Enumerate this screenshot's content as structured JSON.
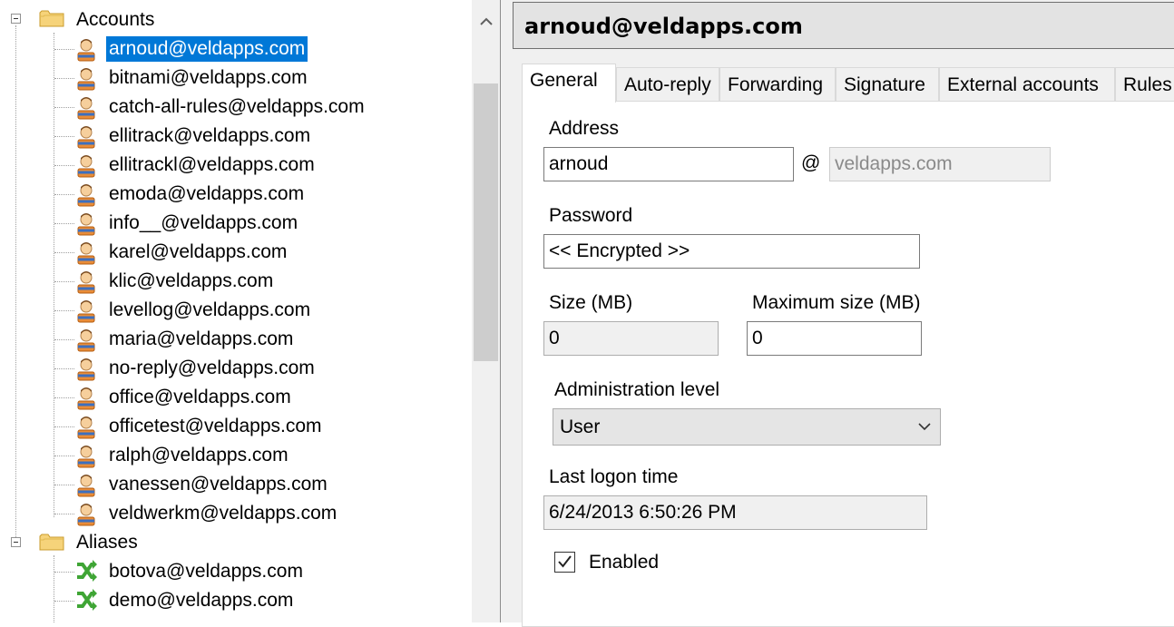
{
  "tree": {
    "accounts_label": "Accounts",
    "accounts": [
      "arnoud@veldapps.com",
      "bitnami@veldapps.com",
      "catch-all-rules@veldapps.com",
      "ellitrack@veldapps.com",
      "ellitrackl@veldapps.com",
      "emoda@veldapps.com",
      "info__@veldapps.com",
      "karel@veldapps.com",
      "klic@veldapps.com",
      "levellog@veldapps.com",
      "maria@veldapps.com",
      "no-reply@veldapps.com",
      "office@veldapps.com",
      "officetest@veldapps.com",
      "ralph@veldapps.com",
      "vanessen@veldapps.com",
      "veldwerkm@veldapps.com"
    ],
    "selected_account": "arnoud@veldapps.com",
    "aliases_label": "Aliases",
    "aliases": [
      "botova@veldapps.com",
      "demo@veldapps.com"
    ],
    "icons": {
      "folder": "folder-icon",
      "account": "user-account-icon",
      "alias": "alias-icon",
      "expander": "tree-collapse-icon",
      "scroll_up": "chevron-up-icon"
    }
  },
  "detail": {
    "title": "arnoud@veldapps.com",
    "tabs": [
      "General",
      "Auto-reply",
      "Forwarding",
      "Signature",
      "External accounts",
      "Rules"
    ],
    "active_tab": "General",
    "address_label": "Address",
    "address_value": "arnoud",
    "at_sign": "@",
    "domain_value": "veldapps.com",
    "password_label": "Password",
    "password_value": "<< Encrypted >>",
    "size_label": "Size (MB)",
    "size_value": "0",
    "max_size_label": "Maximum size (MB)",
    "max_size_value": "0",
    "admin_level_label": "Administration level",
    "admin_level_value": "User",
    "last_logon_label": "Last logon time",
    "last_logon_value": "6/24/2013 6:50:26 PM",
    "enabled_label": "Enabled",
    "enabled_checked": true
  },
  "colors": {
    "selection": "#0078d7",
    "alias_icon_green": "#3fa535",
    "folder_yellow": "#f6d37a"
  }
}
